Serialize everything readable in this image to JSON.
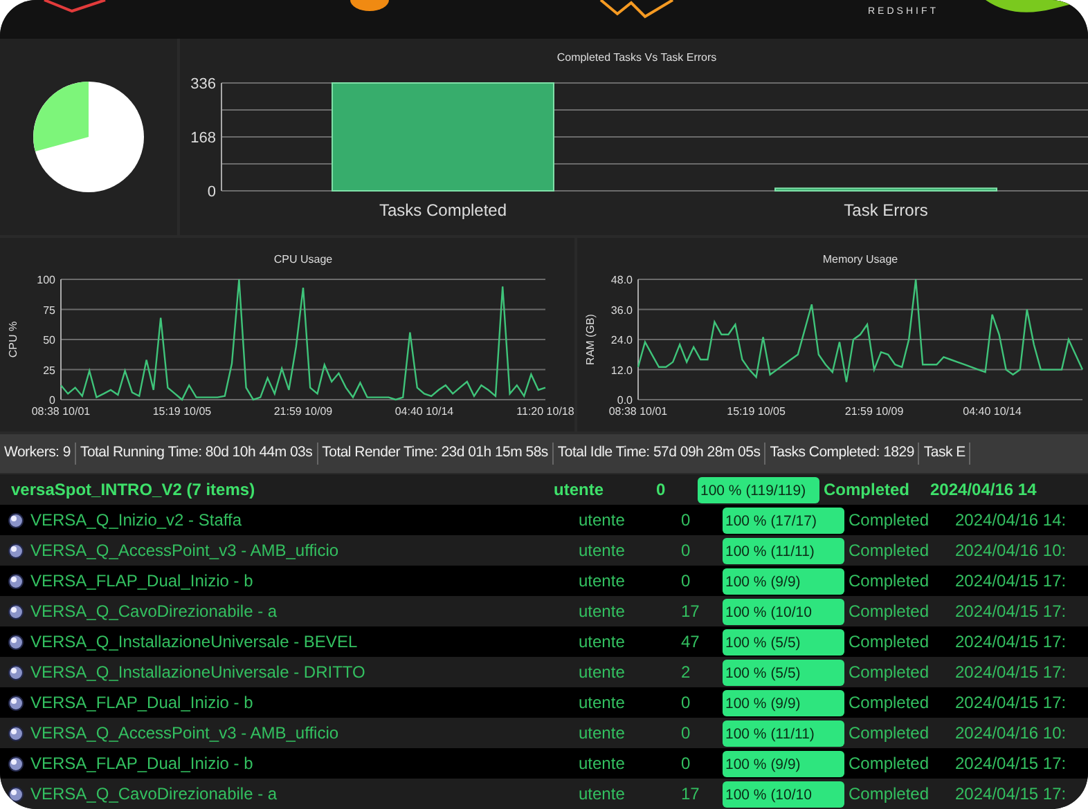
{
  "header": {
    "logo_text": "REDSHIFT"
  },
  "bar_chart": {
    "chart_data": {
      "type": "bar",
      "title": "Completed Tasks Vs Task Errors",
      "categories": [
        "Tasks Completed",
        "Task Errors"
      ],
      "values": [
        336,
        8
      ],
      "ylim": [
        0,
        336
      ],
      "yticks": [
        {
          "value": 0,
          "label": "0"
        },
        {
          "value": 168,
          "label": "168"
        },
        {
          "value": 336,
          "label": "336"
        }
      ],
      "grid": true
    }
  },
  "cpu_chart": {
    "chart_data": {
      "type": "line",
      "title": "CPU Usage",
      "ylabel": "CPU %",
      "categories": [
        "08:38 10/01",
        null,
        null,
        null,
        null,
        null,
        null,
        null,
        null,
        null,
        null,
        null,
        null,
        null,
        null,
        null,
        null,
        "15:19 10/05",
        null,
        null,
        null,
        null,
        null,
        null,
        null,
        null,
        null,
        null,
        null,
        null,
        null,
        null,
        null,
        null,
        "21:59 10/09",
        null,
        null,
        null,
        null,
        null,
        null,
        null,
        null,
        null,
        null,
        null,
        null,
        null,
        null,
        null,
        null,
        "04:40 10/14",
        null,
        null,
        null,
        null,
        null,
        null,
        null,
        null,
        null,
        null,
        null,
        null,
        null,
        null,
        null,
        null,
        "11:20 10/18"
      ],
      "ylim": [
        0,
        100
      ],
      "grid": true,
      "yticks": [
        {
          "value": 0,
          "label": "0"
        },
        {
          "value": 25,
          "label": "25"
        },
        {
          "value": 50,
          "label": "50"
        },
        {
          "value": 75,
          "label": "75"
        },
        {
          "value": 100,
          "label": "100"
        }
      ],
      "series": [
        {
          "color": "#3fc47a",
          "values": [
            12,
            5,
            10,
            3,
            24,
            2,
            5,
            8,
            4,
            24,
            6,
            3,
            33,
            8,
            68,
            10,
            5,
            0,
            12,
            2,
            2,
            2,
            2,
            3,
            30,
            100,
            10,
            0,
            2,
            18,
            5,
            26,
            8,
            44,
            93,
            10,
            5,
            29,
            15,
            22,
            10,
            2,
            14,
            2,
            2,
            2,
            2,
            0,
            2,
            56,
            10,
            5,
            3,
            8,
            12,
            5,
            10,
            15,
            3,
            12,
            8,
            3,
            94,
            5,
            12,
            3,
            21,
            8,
            10
          ]
        }
      ]
    }
  },
  "memory_chart": {
    "chart_data": {
      "type": "line",
      "title": "Memory Usage",
      "ylabel": "RAM (GB)",
      "categories": [
        "08:38 10/01",
        null,
        null,
        null,
        null,
        null,
        null,
        null,
        null,
        null,
        null,
        null,
        null,
        null,
        null,
        null,
        null,
        "15:19 10/05",
        null,
        null,
        null,
        null,
        null,
        null,
        null,
        null,
        null,
        null,
        null,
        null,
        null,
        null,
        null,
        null,
        "21:59 10/09",
        null,
        null,
        null,
        null,
        null,
        null,
        null,
        null,
        null,
        null,
        null,
        null,
        null,
        null,
        null,
        null,
        "04:40 10/14",
        null,
        null,
        null,
        null,
        null,
        null,
        null,
        null,
        null,
        null,
        null,
        null,
        null
      ],
      "ylim": [
        0,
        48
      ],
      "grid": true,
      "yticks": [
        {
          "value": 0,
          "label": "0.0"
        },
        {
          "value": 12,
          "label": "12.0"
        },
        {
          "value": 24,
          "label": "24.0"
        },
        {
          "value": 36,
          "label": "36.0"
        },
        {
          "value": 48,
          "label": "48.0"
        }
      ],
      "series": [
        {
          "color": "#3fc47a",
          "values": [
            13,
            23,
            18,
            13,
            13,
            15,
            22,
            15,
            21,
            16,
            16,
            31,
            26,
            26,
            30,
            16,
            12,
            9,
            25,
            10,
            12,
            14,
            16,
            18,
            28,
            38,
            18,
            14,
            11,
            23,
            7,
            24,
            26,
            30,
            12,
            19,
            18,
            14,
            13,
            24,
            48,
            14,
            14,
            14,
            17,
            16,
            15,
            14,
            13,
            12,
            11,
            34,
            26,
            12,
            10,
            12,
            36,
            22,
            12,
            12,
            12,
            12,
            24,
            18,
            12
          ]
        }
      ]
    }
  },
  "status_bar": {
    "items": [
      "Workers: 9",
      "Total Running Time: 80d 10h 44m 03s",
      "Total Render Time: 23d 01h 15m 58s",
      "Total Idle Time: 57d 09h 28m 05s",
      "Tasks Completed: 1829",
      "Task E"
    ]
  },
  "jobs": {
    "group": {
      "name": "versaSpot_INTRO_V2 (7 items)",
      "user": "utente",
      "count": "0",
      "level": 1,
      "progress": "100 % (119/119)",
      "status": "Completed",
      "date": "2024/04/16 14"
    },
    "rows": [
      {
        "name": "VERSA_Q_Inizio_v2 - Staffa",
        "user": "utente",
        "count": "0",
        "level": 1,
        "progress": "100 %  (17/17)",
        "status": "Completed",
        "date": "2024/04/16 14:"
      },
      {
        "name": "VERSA_Q_AccessPoint_v3 - AMB_ufficio",
        "user": "utente",
        "count": "0",
        "level": 1,
        "progress": "100 %  (11/11)",
        "status": "Completed",
        "date": "2024/04/16 10:"
      },
      {
        "name": "VERSA_FLAP_Dual_Inizio - b",
        "user": "utente",
        "count": "0",
        "level": 1,
        "progress": "100 %  (9/9)",
        "status": "Completed",
        "date": "2024/04/15 17:"
      },
      {
        "name": "VERSA_Q_CavoDirezionabile - a",
        "user": "utente",
        "count": "17",
        "level": 1,
        "progress": "100 %  (10/10",
        "status": "Completed",
        "date": "2024/04/15 17:"
      },
      {
        "name": "VERSA_Q_InstallazioneUniversale - BEVEL",
        "user": "utente",
        "count": "47",
        "level": 1,
        "progress": "100 %  (5/5)",
        "status": "Completed",
        "date": "2024/04/15 17:"
      },
      {
        "name": "VERSA_Q_InstallazioneUniversale - DRITTO",
        "user": "utente",
        "count": "2",
        "level": 1,
        "progress": "100 %  (5/5)",
        "status": "Completed",
        "date": "2024/04/15 17:"
      },
      {
        "name": "VERSA_FLAP_Dual_Inizio - b",
        "user": "utente",
        "count": "0",
        "level": 1,
        "progress": "100 %  (9/9)",
        "status": "Completed",
        "date": "2024/04/15 17:"
      },
      {
        "name": "VERSA_Q_AccessPoint_v3 - AMB_ufficio",
        "user": "utente",
        "count": "0",
        "level": 1,
        "progress": "100 %  (11/11)",
        "status": "Completed",
        "date": "2024/04/16 10:"
      },
      {
        "name": "VERSA_FLAP_Dual_Inizio - b",
        "user": "utente",
        "count": "0",
        "level": 1,
        "progress": "100 %  (9/9)",
        "status": "Completed",
        "date": "2024/04/15 17:"
      },
      {
        "name": "VERSA_Q_CavoDirezionabile - a",
        "user": "utente",
        "count": "17",
        "level": 1,
        "progress": "100 %  (10/10",
        "status": "Completed",
        "date": "2024/04/15 17:"
      }
    ]
  }
}
